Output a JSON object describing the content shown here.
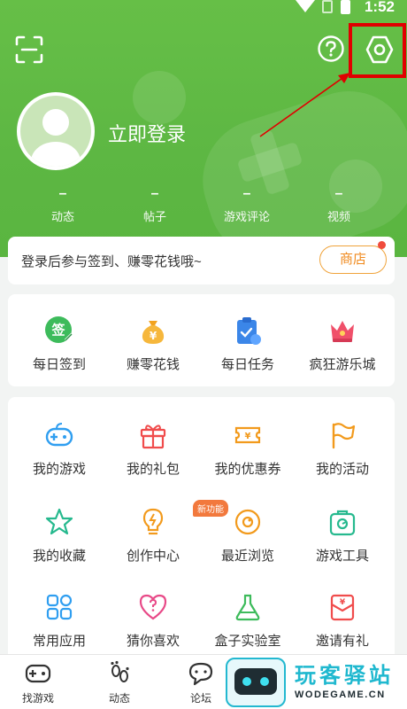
{
  "status_bar": {
    "time": "1:52"
  },
  "header": {
    "scan_icon": "scan-icon",
    "help_icon": "help-icon",
    "settings_icon": "settings-gear-icon"
  },
  "profile": {
    "login_title": "立即登录"
  },
  "stats": [
    {
      "value": "–",
      "label": "动态"
    },
    {
      "value": "–",
      "label": "帖子"
    },
    {
      "value": "–",
      "label": "游戏评论"
    },
    {
      "value": "–",
      "label": "视频"
    }
  ],
  "signin_banner": {
    "text": "登录后参与签到、赚零花钱哦~",
    "shop_label": "商店"
  },
  "quick_actions": [
    {
      "label": "每日签到",
      "icon": "daily-checkin-icon",
      "icon_text": "签"
    },
    {
      "label": "赚零花钱",
      "icon": "money-bag-icon",
      "icon_text": "¥"
    },
    {
      "label": "每日任务",
      "icon": "daily-task-icon"
    },
    {
      "label": "疯狂游乐城",
      "icon": "crown-icon"
    }
  ],
  "features": [
    {
      "label": "我的游戏",
      "icon": "gamepad-icon"
    },
    {
      "label": "我的礼包",
      "icon": "gift-icon"
    },
    {
      "label": "我的优惠券",
      "icon": "coupon-icon"
    },
    {
      "label": "我的活动",
      "icon": "flag-icon"
    },
    {
      "label": "我的收藏",
      "icon": "star-icon"
    },
    {
      "label": "创作中心",
      "icon": "bulb-icon",
      "badge": "新功能"
    },
    {
      "label": "最近浏览",
      "icon": "eye-icon"
    },
    {
      "label": "游戏工具",
      "icon": "toolbox-icon"
    },
    {
      "label": "常用应用",
      "icon": "apps-icon"
    },
    {
      "label": "猜你喜欢",
      "icon": "heart-question-icon"
    },
    {
      "label": "盒子实验室",
      "icon": "flask-icon"
    },
    {
      "label": "邀请有礼",
      "icon": "invite-gift-icon"
    }
  ],
  "bottom_nav": [
    {
      "label": "找游戏",
      "icon": "find-game-icon"
    },
    {
      "label": "动态",
      "icon": "footprint-icon"
    },
    {
      "label": "论坛",
      "icon": "forum-chat-icon"
    }
  ],
  "watermark": {
    "title": "玩客驿站",
    "subtitle": "WODEGAME.CN"
  },
  "colors": {
    "primary_green": "#5db743",
    "accent_orange": "#f08a1e",
    "highlight_red": "#e00000"
  }
}
